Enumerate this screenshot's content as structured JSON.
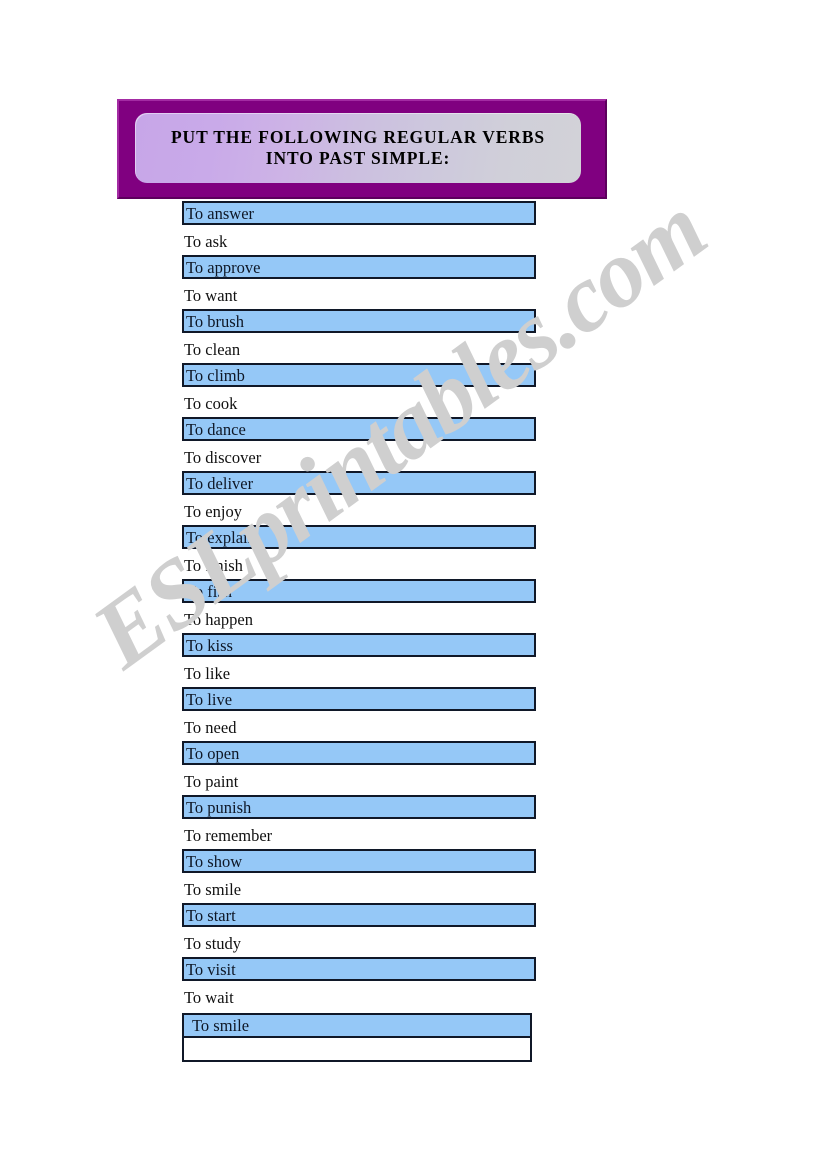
{
  "watermark": {
    "text": "ESLprintables.com",
    "color": "#cfcfcf"
  },
  "header": {
    "title": "PUT THE FOLLOWING REGULAR VERBS\nINTO PAST SIMPLE:",
    "line1": "PUT THE FOLLOWING REGULAR VERBS",
    "line2": "INTO PAST SIMPLE:",
    "frame_color": "#800080",
    "panel_gradient_start": "#c7a6e8",
    "panel_gradient_end": "#d2d2d8"
  },
  "list": {
    "box_fill": "#95c8f7",
    "box_border": "#101828",
    "items": [
      {
        "label": "To answer",
        "style": "boxed"
      },
      {
        "label": "To ask",
        "style": "plain"
      },
      {
        "label": "To approve",
        "style": "boxed"
      },
      {
        "label": "To want",
        "style": "plain"
      },
      {
        "label": "To brush",
        "style": "boxed"
      },
      {
        "label": "To clean",
        "style": "plain"
      },
      {
        "label": "To climb",
        "style": "boxed"
      },
      {
        "label": "To cook",
        "style": "plain"
      },
      {
        "label": "To dance",
        "style": "boxed"
      },
      {
        "label": "To discover",
        "style": "plain"
      },
      {
        "label": "To deliver",
        "style": "boxed"
      },
      {
        "label": "To enjoy",
        "style": "plain"
      },
      {
        "label": "To explain",
        "style": "boxed"
      },
      {
        "label": "To finish",
        "style": "plain"
      },
      {
        "label": "To fish",
        "style": "boxed"
      },
      {
        "label": "To happen",
        "style": "plain"
      },
      {
        "label": "To kiss",
        "style": "boxed"
      },
      {
        "label": "To like",
        "style": "plain"
      },
      {
        "label": "To live",
        "style": "boxed"
      },
      {
        "label": "To need",
        "style": "plain"
      },
      {
        "label": "To open",
        "style": "boxed"
      },
      {
        "label": "To paint",
        "style": "plain"
      },
      {
        "label": "To punish",
        "style": "boxed"
      },
      {
        "label": "To remember",
        "style": "plain"
      },
      {
        "label": "To show",
        "style": "boxed"
      },
      {
        "label": "To smile",
        "style": "plain"
      },
      {
        "label": "To start",
        "style": "boxed"
      },
      {
        "label": "To study",
        "style": "plain"
      },
      {
        "label": "To visit",
        "style": "boxed"
      },
      {
        "label": "To wait",
        "style": "plain"
      }
    ]
  },
  "final_table": {
    "filled_cell": "To smile",
    "empty_cell": ""
  }
}
